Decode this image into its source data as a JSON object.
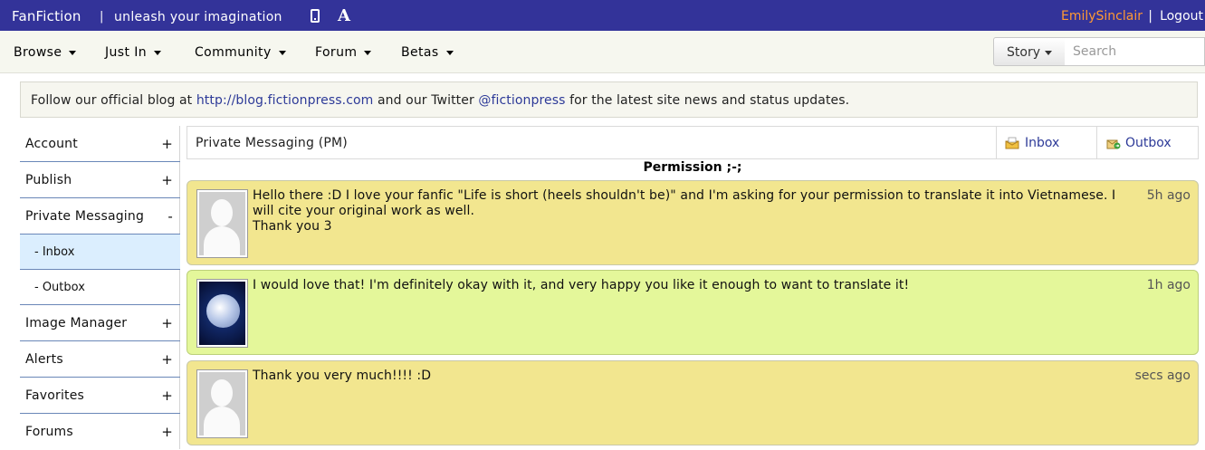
{
  "header": {
    "brand": "FanFiction",
    "separator": "|",
    "tagline": "unleash your imagination",
    "font_icon_label": "A",
    "username": "EmilySinclair",
    "pipe": "|",
    "logout": "Logout"
  },
  "nav": {
    "items": [
      {
        "label": "Browse"
      },
      {
        "label": "Just In"
      },
      {
        "label": "Community"
      },
      {
        "label": "Forum"
      },
      {
        "label": "Betas"
      }
    ],
    "search_scope": "Story",
    "search_placeholder": "Search"
  },
  "notice": {
    "prefix": "Follow our official blog at ",
    "blog_link": "http://blog.fictionpress.com",
    "middle": " and our Twitter ",
    "twitter_link": "@fictionpress",
    "suffix": " for the latest site news and status updates."
  },
  "sidebar": {
    "items": [
      {
        "label": "Account",
        "toggle": "+"
      },
      {
        "label": "Publish",
        "toggle": "+"
      },
      {
        "label": "Private Messaging",
        "toggle": "-"
      },
      {
        "label": "- Inbox"
      },
      {
        "label": "- Outbox"
      },
      {
        "label": "Image Manager",
        "toggle": "+"
      },
      {
        "label": "Alerts",
        "toggle": "+"
      },
      {
        "label": "Favorites",
        "toggle": "+"
      },
      {
        "label": "Forums",
        "toggle": "+"
      }
    ]
  },
  "pm": {
    "title": "Private Messaging (PM)",
    "inbox_label": "Inbox",
    "outbox_label": "Outbox",
    "thread_title": "Permission ;-;",
    "messages": [
      {
        "text": "Hello there :D I love your fanfic \"Life is short (heels shouldn't be)\" and I'm asking for your permission to translate it into Vietnamese. I will cite your original work as well.\nThank you 3",
        "time": "5h ago"
      },
      {
        "text": "I would love that! I'm definitely okay with it, and very happy you like it enough to want to translate it!",
        "time": "1h ago"
      },
      {
        "text": "Thank you very much!!!! :D",
        "time": "secs ago"
      }
    ]
  },
  "colors": {
    "topbar": "#333399",
    "username": "#ff9933",
    "link": "#2d3a98",
    "message_yellow": "#f2e68f",
    "message_green": "#e4f79a",
    "sidebar_active": "#dbeefe"
  }
}
